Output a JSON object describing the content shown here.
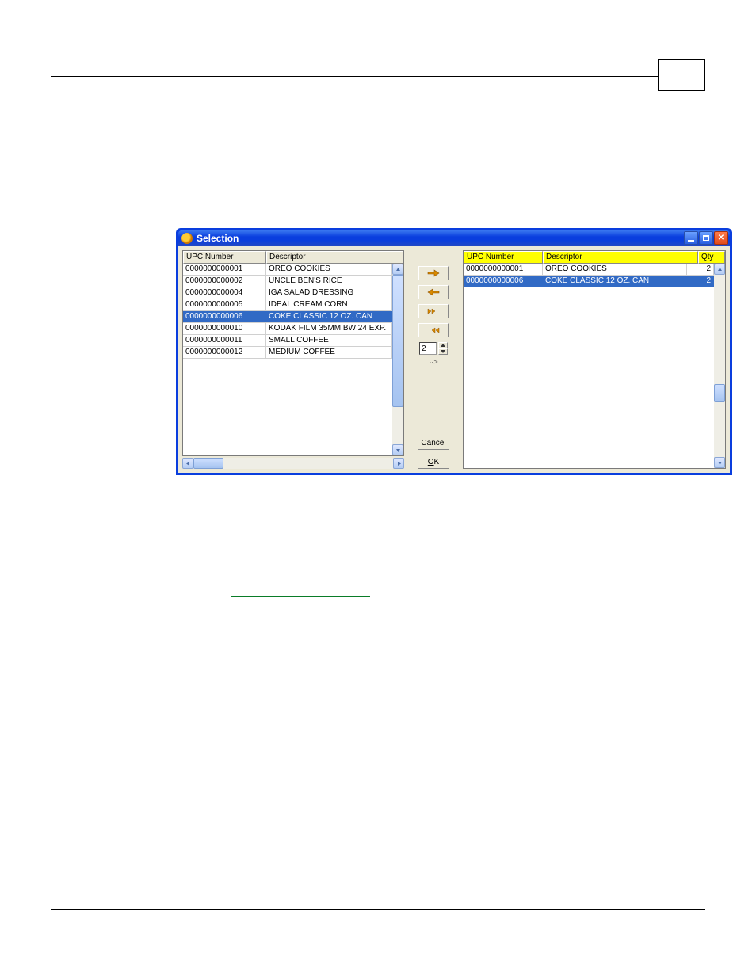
{
  "window": {
    "title": "Selection",
    "buttons": {
      "cancel": "Cancel",
      "ok": "OK",
      "ok_underline": "O"
    },
    "spinner_value": "2"
  },
  "left": {
    "headers": {
      "col0": "UPC Number",
      "col1": "Descriptor"
    },
    "rows": [
      {
        "upc": "0000000000001",
        "desc": "OREO COOKIES",
        "selected": false
      },
      {
        "upc": "0000000000002",
        "desc": "UNCLE BEN'S RICE",
        "selected": false
      },
      {
        "upc": "0000000000004",
        "desc": "IGA SALAD DRESSING",
        "selected": false
      },
      {
        "upc": "0000000000005",
        "desc": "IDEAL CREAM CORN",
        "selected": false
      },
      {
        "upc": "0000000000006",
        "desc": "COKE CLASSIC 12 OZ. CAN",
        "selected": true
      },
      {
        "upc": "0000000000010",
        "desc": "KODAK FILM 35MM BW 24 EXP.",
        "selected": false
      },
      {
        "upc": "0000000000011",
        "desc": "SMALL COFFEE",
        "selected": false
      },
      {
        "upc": "0000000000012",
        "desc": "MEDIUM COFFEE",
        "selected": false
      }
    ]
  },
  "right": {
    "headers": {
      "col0": "UPC Number",
      "col1": "Descriptor",
      "col2": "Qty"
    },
    "rows": [
      {
        "upc": "0000000000001",
        "desc": "OREO COOKIES",
        "qty": "2",
        "selected": false
      },
      {
        "upc": "0000000000006",
        "desc": "COKE CLASSIC 12 OZ. CAN",
        "qty": "2",
        "selected": true
      }
    ]
  }
}
